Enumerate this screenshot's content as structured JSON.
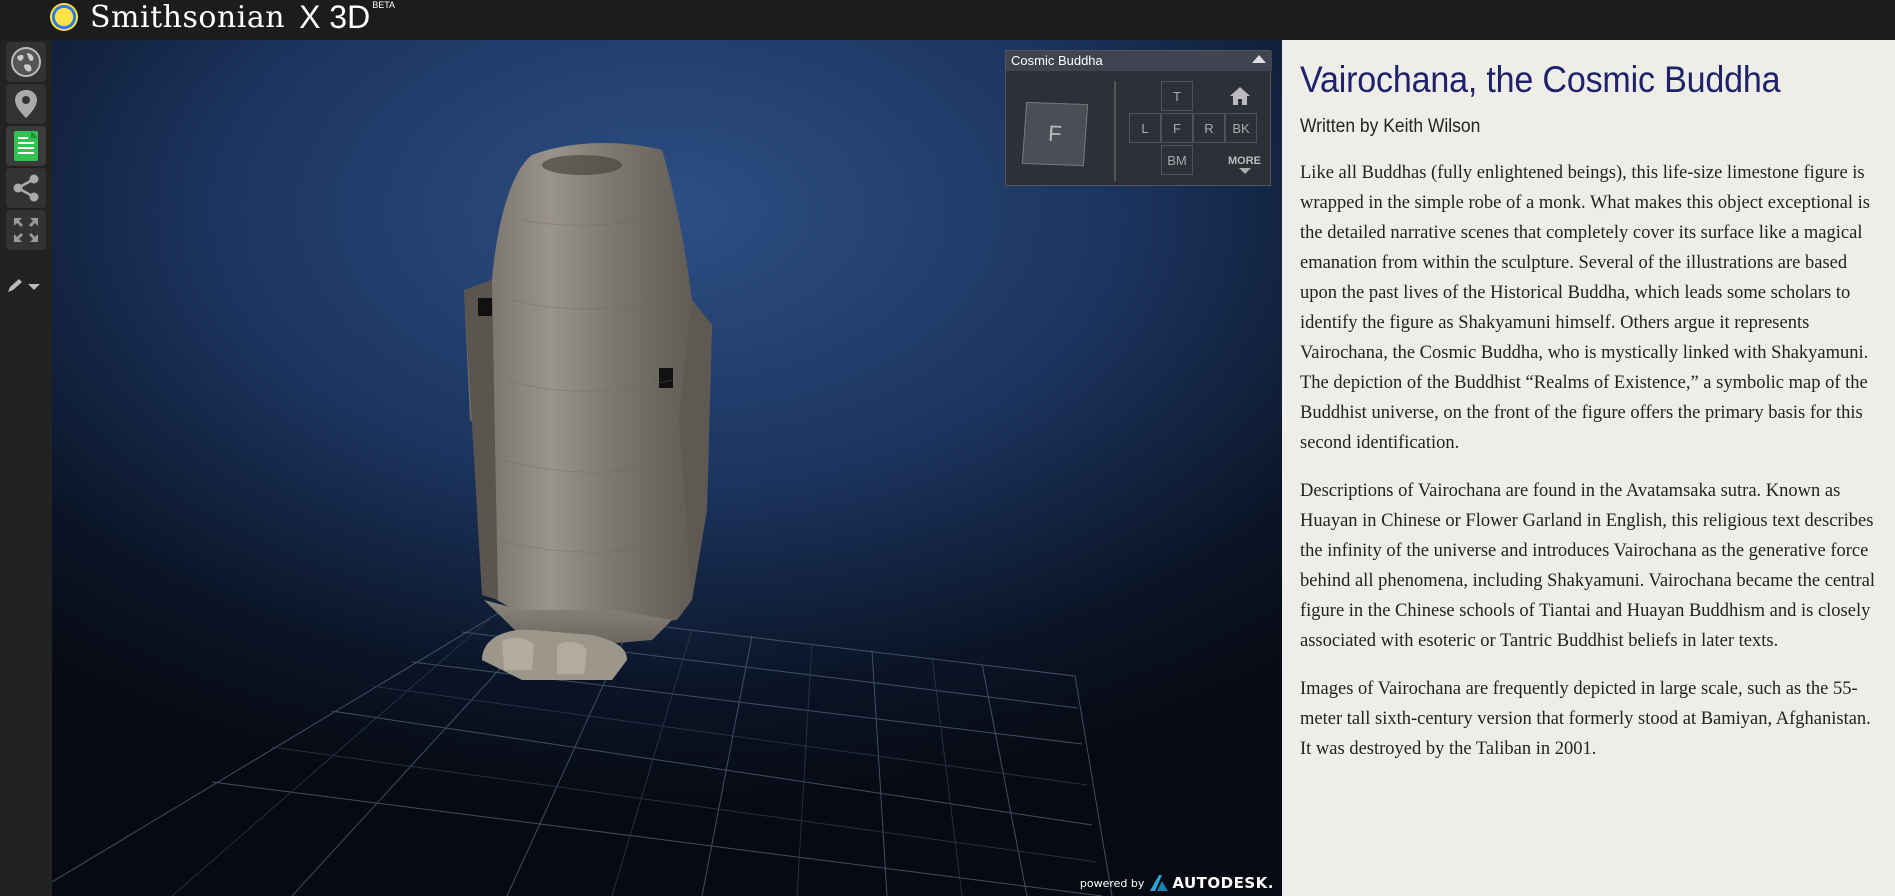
{
  "header": {
    "brand": "Smithsonian",
    "product": "X 3D",
    "badge": "BETA"
  },
  "sidebar": {
    "items": [
      {
        "name": "globe-icon"
      },
      {
        "name": "location-pin-icon"
      },
      {
        "name": "document-icon",
        "active": true,
        "accent": "#32c252"
      },
      {
        "name": "share-icon"
      },
      {
        "name": "fullscreen-icon"
      },
      {
        "name": "pencil-dropdown-icon"
      }
    ]
  },
  "viewport": {
    "powered_small": "powered by",
    "powered_brand": "AUTODESK.",
    "background_color": "#1c3560",
    "grid_color": "#4a5b70"
  },
  "viewcube": {
    "title": "Cosmic Buddha",
    "cube_face": "F",
    "buttons": {
      "top": "T",
      "left": "L",
      "front": "F",
      "right": "R",
      "back": "BK",
      "bottom": "BM"
    },
    "more": "MORE"
  },
  "article": {
    "title": "Vairochana, the Cosmic Buddha",
    "author": "Written by Keith Wilson",
    "paragraphs": [
      "Like all Buddhas (fully enlightened beings), this life-size limestone figure is wrapped in the simple robe of a monk. What makes this object exceptional is the detailed narrative scenes that completely cover its surface like a magical emanation from within the sculpture. Several of the illustrations are based upon the past lives of the Historical Buddha, which leads some scholars to identify the figure as Shakyamuni himself. Others argue it represents Vairochana, the Cosmic Buddha, who is mystically linked with Shakyamuni. The depiction of the Buddhist “Realms of Existence,” a symbolic map of the Buddhist universe, on the front of the figure offers the primary basis for this second identification.",
      "Descriptions of Vairochana are found in the Avatamsaka sutra. Known as Huayan in Chinese or Flower Garland in English, this religious text describes the infinity of the universe and introduces Vairochana as the generative force behind all phenomena, including Shakyamuni. Vairochana became the central figure in the Chinese schools of Tiantai and Huayan Buddhism and is closely associated with esoteric or Tantric Buddhist beliefs in later texts.",
      "Images of Vairochana are frequently depicted in large scale, such as the 55-meter tall sixth-century version that formerly stood at Bamiyan, Afghanistan. It was destroyed by the Taliban in 2001."
    ],
    "title_color": "#1f226b",
    "background_color": "#eeede8"
  }
}
